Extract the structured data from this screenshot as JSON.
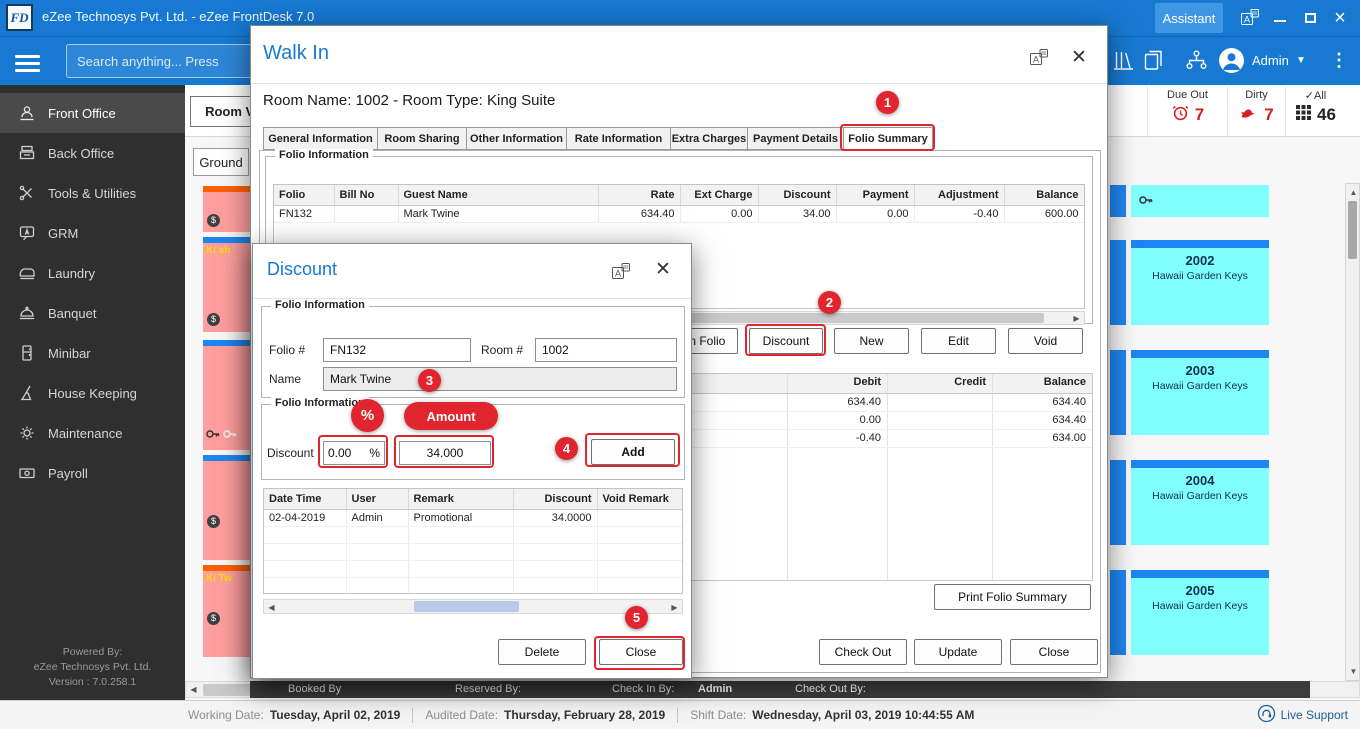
{
  "colors": {
    "titlebar_blue": "#1779d2",
    "annotation_red": "#e1252e",
    "tile_pink": "#ff9e9e",
    "tile_orange": "#ff5f00",
    "tile_blue": "#1e86f0",
    "tile_cyan": "#80ffff"
  },
  "titlebar": {
    "logo": "FD",
    "title": "eZee Technosys Pvt. Ltd. - eZee FrontDesk 7.0",
    "assistant_label": "Assistant"
  },
  "toolbar": {
    "search_placeholder": "Search anything... Press",
    "user_name": "Admin"
  },
  "sidebar": {
    "items": [
      {
        "label": "Front Office"
      },
      {
        "label": "Back Office"
      },
      {
        "label": "Tools & Utilities"
      },
      {
        "label": "GRM"
      },
      {
        "label": "Laundry"
      },
      {
        "label": "Banquet"
      },
      {
        "label": "Minibar"
      },
      {
        "label": "House Keeping"
      },
      {
        "label": "Maintenance"
      },
      {
        "label": "Payroll"
      }
    ],
    "footer": {
      "line1": "Powered By:",
      "line2": "eZee Technosys Pvt. Ltd.",
      "line3": "Version : 7.0.258.1"
    }
  },
  "room_view": {
    "view_button_label": "Room View",
    "floor_tab_label": "Ground",
    "left_tiles": [
      {
        "text": ""
      },
      {
        "text": "Ki sh"
      },
      {
        "text": ""
      },
      {
        "text": ""
      },
      {
        "text": "Ki Tw"
      }
    ],
    "right_tiles": [
      {
        "number": "2002",
        "name": "Hawaii Garden Keys"
      },
      {
        "number": "2003",
        "name": "Hawaii Garden Keys"
      },
      {
        "number": "2004",
        "name": "Hawaii Garden Keys"
      },
      {
        "number": "2005",
        "name": "Hawaii Garden Keys"
      }
    ],
    "counters": [
      {
        "label": "Due Out",
        "value": "7"
      },
      {
        "label": "Dirty",
        "value": "7"
      },
      {
        "label": "All",
        "value": "46",
        "check": "✓"
      }
    ],
    "footer_bar": {
      "booked_by": "Booked By",
      "reserved_by": "Reserved By:",
      "check_in_by": "Check In By:",
      "check_in_user": "Admin",
      "check_out_by": "Check Out By:"
    }
  },
  "walkin": {
    "title": "Walk In",
    "room_header": "Room Name: 1002 - Room Type: King Suite",
    "tabs": [
      {
        "label": "General Information"
      },
      {
        "label": "Room Sharing"
      },
      {
        "label": "Other Information"
      },
      {
        "label": "Rate Information"
      },
      {
        "label": "Extra Charges"
      },
      {
        "label": "Payment Details"
      },
      {
        "label": "Folio Summary"
      }
    ],
    "folio_group_title": "Folio Information",
    "folio_table": {
      "headers": [
        "Folio",
        "Bill No",
        "Guest Name",
        "Rate",
        "Ext Charge",
        "Discount",
        "Payment",
        "Adjustment",
        "Balance"
      ],
      "row": {
        "folio": "FN132",
        "bill_no": "",
        "guest_name": "Mark Twine",
        "rate": "634.40",
        "ext_charge": "0.00",
        "discount": "34.00",
        "payment": "0.00",
        "adjustment": "-0.40",
        "balance": "600.00"
      }
    },
    "buttons": {
      "open_folio": "Open Folio",
      "discount": "Discount",
      "new": "New",
      "edit": "Edit",
      "void": "Void"
    },
    "summary_table": {
      "headers": [
        "Debit",
        "Credit",
        "Balance"
      ],
      "rows": [
        {
          "debit": "634.40",
          "credit": "",
          "balance": "634.40"
        },
        {
          "debit": "0.00",
          "credit": "",
          "balance": "634.40"
        },
        {
          "debit": "-0.40",
          "credit": "",
          "balance": "634.00"
        }
      ]
    },
    "print_button": "Print Folio Summary",
    "checkout_button": "Check Out",
    "update_button": "Update",
    "close_button": "Close"
  },
  "discount_dialog": {
    "title": "Discount",
    "group1_title": "Folio Information",
    "folio_label": "Folio #",
    "folio_value": "FN132",
    "room_label": "Room #",
    "room_value": "1002",
    "name_label": "Name",
    "name_value": "Mark Twine",
    "group2_title": "Folio Information",
    "discount_label": "Discount",
    "percent_value": "0.00",
    "percent_unit": "%",
    "amount_value": "34.000",
    "add_button": "Add",
    "history_table": {
      "headers": [
        "Date Time",
        "User",
        "Remark",
        "Discount",
        "Void Remark"
      ],
      "row": {
        "date_time": "02-04-2019",
        "user": "Admin",
        "remark": "Promotional",
        "discount": "34.0000",
        "void_remark": ""
      }
    },
    "delete_button": "Delete",
    "close_button": "Close"
  },
  "annotations": {
    "step1": "1",
    "step2": "2",
    "step3": "3",
    "step4": "4",
    "step5": "5",
    "percent_badge": "%",
    "amount_badge": "Amount"
  },
  "statusbar": {
    "working_date_label": "Working Date:",
    "working_date": "Tuesday, April 02, 2019",
    "audited_date_label": "Audited Date:",
    "audited_date": "Thursday, February 28, 2019",
    "shift_date_label": "Shift Date:",
    "shift_date": "Wednesday, April 03, 2019 10:44:55 AM",
    "live_support": "Live Support"
  }
}
